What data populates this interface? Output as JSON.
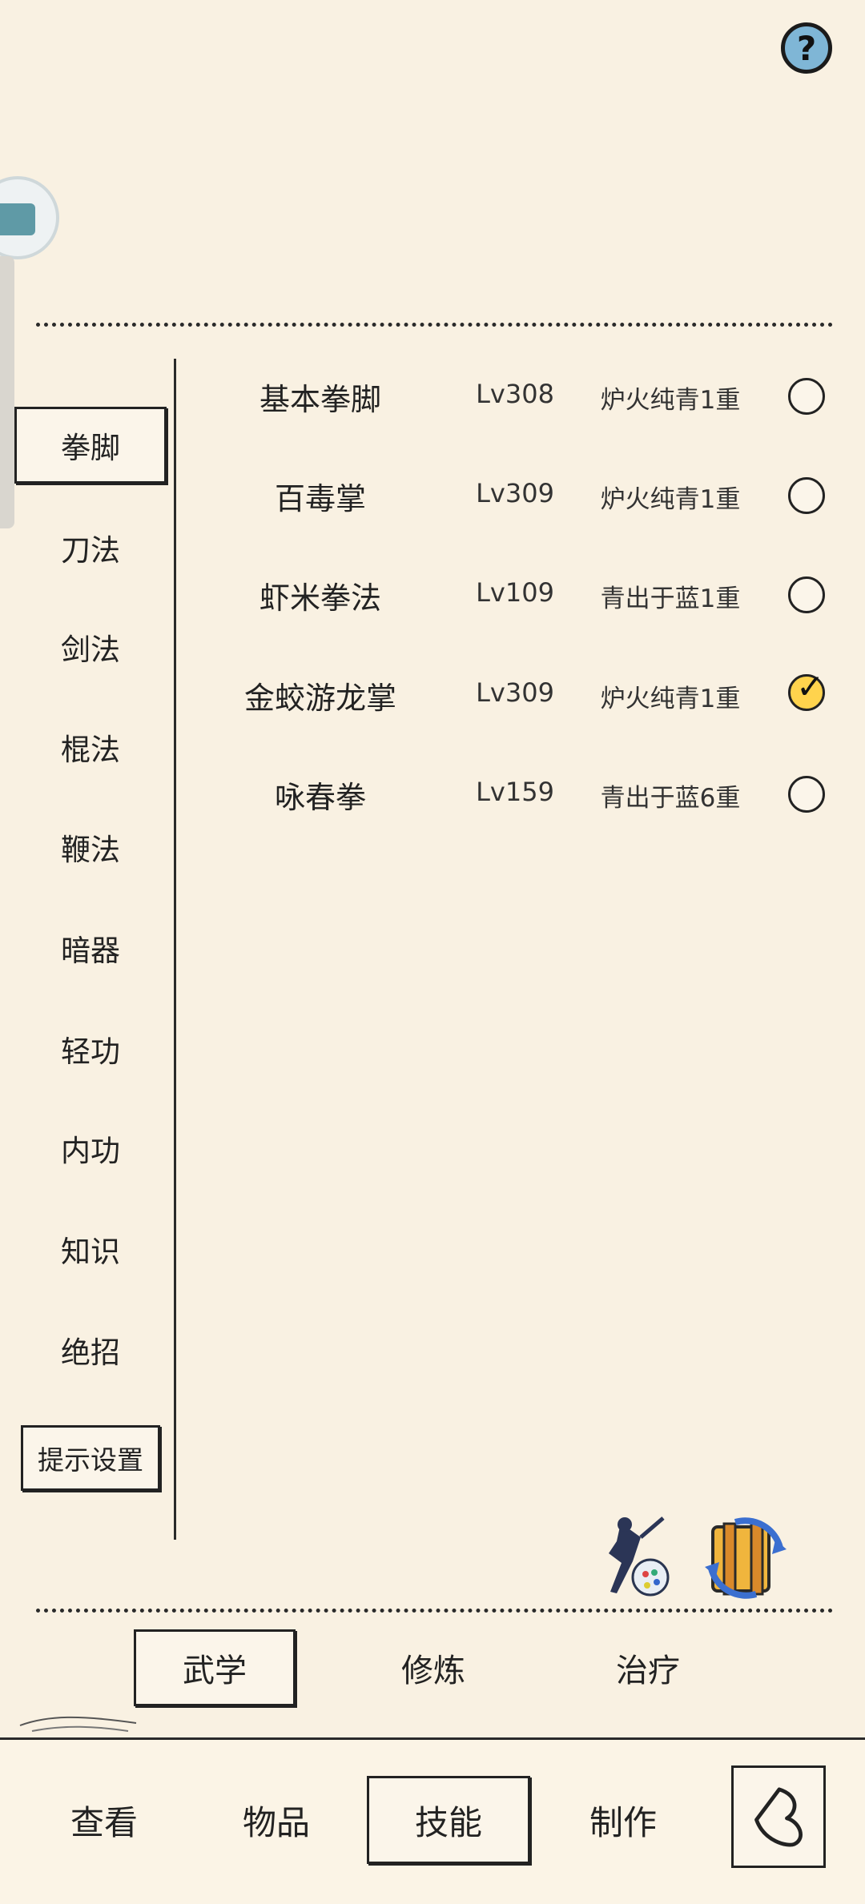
{
  "help": {
    "label": "?"
  },
  "categories": [
    {
      "label": "拳脚",
      "active": true
    },
    {
      "label": "刀法"
    },
    {
      "label": "剑法"
    },
    {
      "label": "棍法"
    },
    {
      "label": "鞭法"
    },
    {
      "label": "暗器"
    },
    {
      "label": "轻功"
    },
    {
      "label": "内功"
    },
    {
      "label": "知识"
    },
    {
      "label": "绝招"
    }
  ],
  "hint_settings_label": "提示设置",
  "skills": [
    {
      "name": "基本拳脚",
      "level": "Lv308",
      "rank": "炉火纯青1重",
      "selected": false
    },
    {
      "name": "百毒掌",
      "level": "Lv309",
      "rank": "炉火纯青1重",
      "selected": false
    },
    {
      "name": "虾米拳法",
      "level": "Lv109",
      "rank": "青出于蓝1重",
      "selected": false
    },
    {
      "name": "金蛟游龙掌",
      "level": "Lv309",
      "rank": "炉火纯青1重",
      "selected": true
    },
    {
      "name": "咏春拳",
      "level": "Lv159",
      "rank": "青出于蓝6重",
      "selected": false
    }
  ],
  "checkmark": "✓",
  "sub_tabs": [
    {
      "label": "武学",
      "active": true
    },
    {
      "label": "修炼"
    },
    {
      "label": "治疗"
    }
  ],
  "bottom_nav": [
    {
      "label": "查看"
    },
    {
      "label": "物品"
    },
    {
      "label": "技能",
      "active": true
    },
    {
      "label": "制作"
    }
  ],
  "colors": {
    "background": "#f9f1e2",
    "help_button": "#7fb6d6",
    "checked_radio": "#ffd34d"
  }
}
